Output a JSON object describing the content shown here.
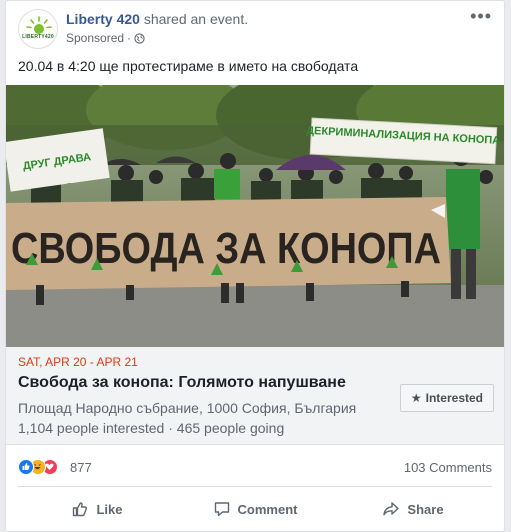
{
  "post": {
    "page_name": "Liberty 420",
    "action_text": " shared an event.",
    "sponsored": "Sponsored",
    "dot": " · ",
    "text": "20.04 в 4:20 ще протестираме в името на свободата",
    "avatar_text": "LIBERTY420"
  },
  "photo": {
    "banner_main": "СВОБОДА ЗА КОНОПА",
    "banner_right": "ДЕКРИМИНАЛИЗАЦИЯ НА КОНОПА",
    "banner_left": "ДРУГ ДРАВА"
  },
  "event": {
    "date": "SAT, APR 20 - APR 21",
    "title": "Свобода за конопа: Голямото напушване",
    "location": "Площад Народно събрание, 1000 София, България",
    "interested": "1,104 people interested",
    "separator": " · ",
    "going": "465 people going",
    "interested_button": "Interested"
  },
  "reactions": {
    "count": "877",
    "comments": "103 Comments",
    "types": [
      "like",
      "haha",
      "love"
    ]
  },
  "actions": {
    "like": "Like",
    "comment": "Comment",
    "share": "Share"
  },
  "colors": {
    "link": "#385898",
    "date_red": "#dd3c10",
    "like_blue": "#1877f2",
    "love_red": "#f33e58",
    "haha_yellow": "#f7b125"
  }
}
